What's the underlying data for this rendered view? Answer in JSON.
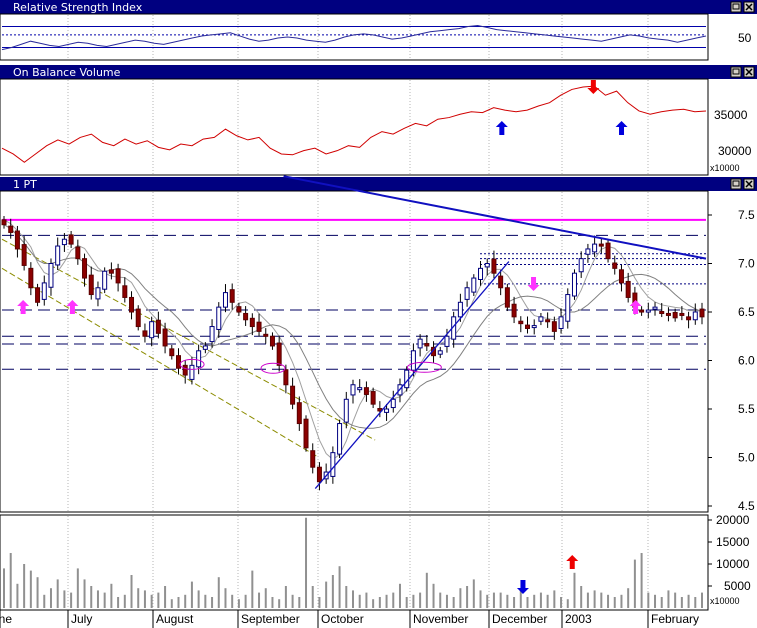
{
  "colors": {
    "title_bar": "#000080",
    "up_candle": "#ffffff",
    "down_candle": "#8b0000",
    "rsi_line": "#2a2a9a",
    "obv_line": "#d00000",
    "resistance": "#ff00ff",
    "trend_line": "#1010c0",
    "channel": "#8c8c00",
    "ma": "#808080",
    "volume_bar": "#909090",
    "magenta_arrow": "#ff33ff",
    "blue_arrow": "#0000dd",
    "red_arrow": "#ee0000",
    "circle": "#cc00cc"
  },
  "window_buttons": [
    "restore-icon",
    "close-icon"
  ],
  "chart_data": [
    {
      "id": "rsi",
      "type": "line",
      "title": "Relative Strength Index",
      "yticks": [
        "50"
      ],
      "ylim": [
        30,
        70
      ],
      "reference_lines": [
        60,
        52,
        40
      ],
      "series": [
        {
          "values": [
            38,
            40,
            43,
            46,
            44,
            42,
            41,
            43,
            45,
            44,
            42,
            41,
            43,
            45,
            47,
            46,
            44,
            43,
            45,
            47,
            49,
            51,
            52,
            53,
            54,
            51,
            48,
            46,
            47,
            49,
            50,
            49,
            47,
            46,
            45,
            47,
            50,
            52,
            53,
            52,
            50,
            48,
            49,
            51,
            53,
            55,
            56,
            57,
            58,
            60,
            61,
            59,
            57,
            56,
            55,
            54,
            53,
            52,
            51,
            50,
            49,
            48,
            47,
            46,
            48,
            50,
            52,
            51,
            49,
            48,
            47,
            45,
            47,
            49,
            51
          ]
        }
      ]
    },
    {
      "id": "obv",
      "type": "line",
      "title": "On Balance Volume",
      "yticks": [
        "35000",
        "30000"
      ],
      "ylim": [
        27500,
        38500
      ],
      "unit_label": "x10000",
      "series": [
        {
          "values": [
            30500,
            29800,
            28800,
            29800,
            30800,
            31500,
            31000,
            31800,
            32200,
            31200,
            30800,
            31600,
            31000,
            31400,
            30600,
            30300,
            31000,
            30800,
            31600,
            31800,
            32800,
            32000,
            31500,
            31800,
            30500,
            29800,
            29700,
            30200,
            30500,
            29800,
            30200,
            30800,
            30600,
            31800,
            32500,
            32200,
            32900,
            33500,
            33200,
            34000,
            34200,
            34600,
            34900,
            34800,
            35400,
            35100,
            34900,
            35100,
            35600,
            36000,
            36900,
            37600,
            37900,
            38000,
            36900,
            37400,
            36000,
            35000,
            34600,
            34900,
            35100,
            35200,
            34900,
            35000
          ]
        }
      ],
      "markers": [
        {
          "type": "up-arrow",
          "color": "blue",
          "x": 0.71
        },
        {
          "type": "up-arrow",
          "color": "blue",
          "x": 0.88
        },
        {
          "type": "down-arrow",
          "color": "red",
          "x": 0.84
        }
      ]
    },
    {
      "id": "price",
      "type": "candlestick",
      "title": "1 PT",
      "yticks": [
        "7.5",
        "7.0",
        "6.5",
        "6.0",
        "5.5",
        "5.0",
        "4.5"
      ],
      "ylim": [
        4.3,
        7.7
      ],
      "horizontal_lines": {
        "resistance_solid": 7.45,
        "dashed": [
          7.29,
          6.52,
          6.25,
          6.17,
          5.91
        ],
        "dotted": [
          7.1,
          7.05,
          6.99,
          6.79
        ]
      },
      "close": [
        7.4,
        7.32,
        7.15,
        6.98,
        6.75,
        6.6,
        6.8,
        7.0,
        7.18,
        7.25,
        7.2,
        7.05,
        6.85,
        6.68,
        6.75,
        6.92,
        6.9,
        6.8,
        6.65,
        6.5,
        6.35,
        6.25,
        6.4,
        6.28,
        6.15,
        6.05,
        5.92,
        5.85,
        5.95,
        6.1,
        6.15,
        6.35,
        6.55,
        6.7,
        6.6,
        6.5,
        6.42,
        6.35,
        6.3,
        6.25,
        6.15,
        5.95,
        5.75,
        5.55,
        5.35,
        5.1,
        4.9,
        4.75,
        4.85,
        5.05,
        5.35,
        5.6,
        5.75,
        5.72,
        5.65,
        5.55,
        5.48,
        5.5,
        5.6,
        5.75,
        5.9,
        6.1,
        6.22,
        6.15,
        6.05,
        6.1,
        6.25,
        6.45,
        6.6,
        6.75,
        6.85,
        6.95,
        7.0,
        6.9,
        6.75,
        6.55,
        6.45,
        6.38,
        6.33,
        6.36,
        6.45,
        6.4,
        6.3,
        6.45,
        6.68,
        6.9,
        7.05,
        7.15,
        7.2,
        7.18,
        7.05,
        6.95,
        6.8,
        6.65,
        6.55,
        6.5,
        6.52,
        6.55,
        6.5,
        6.48,
        6.44,
        6.48,
        6.42,
        6.5,
        6.45
      ],
      "trend_lines": [
        {
          "name": "downtrend",
          "points": [
            [
              0.4,
              7.9
            ],
            [
              1.0,
              7.05
            ]
          ]
        },
        {
          "name": "uptrend",
          "points": [
            [
              0.445,
              4.68
            ],
            [
              0.72,
              7.02
            ]
          ]
        }
      ],
      "channel": [
        {
          "points": [
            [
              0.0,
              7.25
            ],
            [
              0.53,
              5.18
            ]
          ]
        },
        {
          "points": [
            [
              0.0,
              6.95
            ],
            [
              0.45,
              5.0
            ]
          ]
        }
      ],
      "markers": [
        {
          "type": "up-arrow",
          "color": "magenta",
          "x": 0.03
        },
        {
          "type": "up-arrow",
          "color": "magenta",
          "x": 0.1
        },
        {
          "type": "down-arrow",
          "color": "magenta",
          "x": 0.755
        },
        {
          "type": "up-arrow",
          "color": "magenta",
          "x": 0.9
        },
        {
          "type": "circle",
          "x": 0.27
        },
        {
          "type": "circle",
          "x": 0.385
        },
        {
          "type": "circle",
          "x": 0.6
        }
      ]
    },
    {
      "id": "volume",
      "type": "bar",
      "yticks": [
        "20000",
        "15000",
        "10000",
        "5000"
      ],
      "ylim": [
        0,
        22000
      ],
      "unit_label": "x10000",
      "values": [
        9000,
        12500,
        5500,
        10000,
        8500,
        7000,
        3000,
        4500,
        6500,
        4000,
        3500,
        9000,
        6500,
        5000,
        4000,
        3500,
        5500,
        2500,
        3000,
        7500,
        4500,
        4000,
        3000,
        3500,
        5000,
        2000,
        2500,
        3000,
        6000,
        4000,
        3000,
        2500,
        7000,
        4500,
        3000,
        2000,
        3000,
        8500,
        3500,
        4500,
        2500,
        2000,
        5000,
        3000,
        2500,
        20500,
        5000,
        2500,
        6000,
        7500,
        9500,
        5000,
        4000,
        3000,
        3500,
        2000,
        2500,
        3000,
        3500,
        5500,
        2500,
        3000,
        3500,
        8000,
        5500,
        3500,
        3000,
        2500,
        4500,
        5000,
        6500,
        4000,
        3000,
        3500,
        3500,
        3000,
        2500,
        4000,
        2500,
        3000,
        3500,
        3000,
        4000,
        2500,
        2000,
        8000,
        5000,
        3500,
        4000,
        3500,
        3000,
        2500,
        3000,
        4500,
        11000,
        12500,
        3500,
        3000,
        2500,
        4000,
        3500,
        2500,
        3000,
        2500,
        3500
      ],
      "markers": [
        {
          "type": "down-arrow",
          "color": "blue",
          "x": 0.74
        },
        {
          "type": "up-arrow",
          "color": "red",
          "x": 0.81
        }
      ]
    }
  ],
  "x_axis": {
    "months": [
      "June",
      "July",
      "August",
      "September",
      "October",
      "November",
      "December",
      "2003",
      "February"
    ]
  }
}
